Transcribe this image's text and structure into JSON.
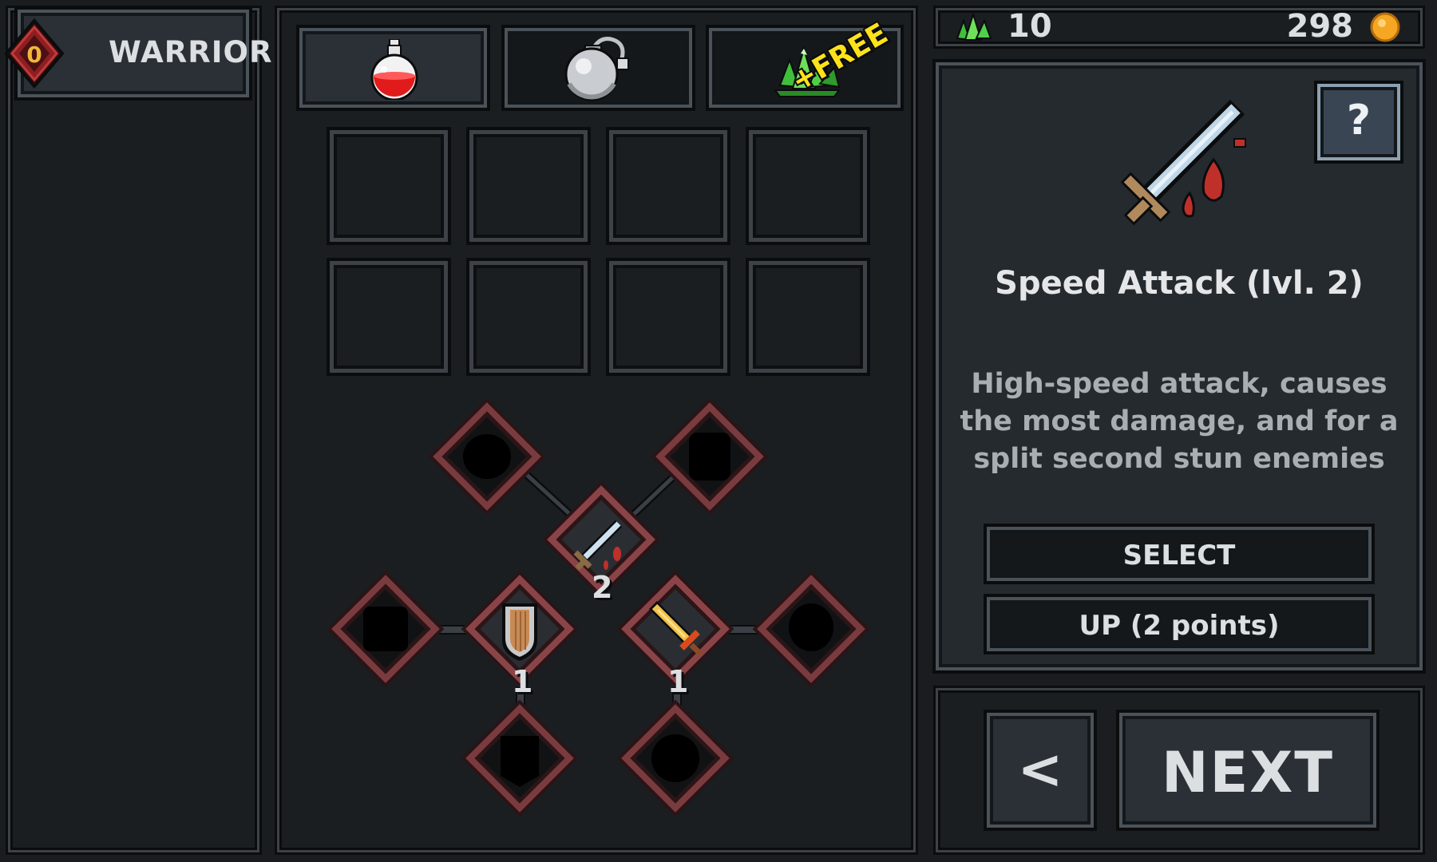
{
  "player": {
    "class_name": "WARRIOR",
    "level": "0"
  },
  "tabs": [
    {
      "name": "potion",
      "icon": "potion-icon"
    },
    {
      "name": "bomb",
      "icon": "bomb-icon"
    },
    {
      "name": "gems",
      "icon": "gem-icon",
      "badge": "+FREE"
    }
  ],
  "currency": {
    "gems": "10",
    "coins": "298"
  },
  "skill": {
    "title": "Speed Attack (lvl. 2)",
    "description": "High-speed attack, causes the most damage, and for a split second stun enemies",
    "select_label": "SELECT",
    "up_label": "UP (2 points)"
  },
  "tree": {
    "speed_attack_level": "2",
    "shield_level": "1",
    "fire_sword_level": "1"
  },
  "nav": {
    "back_label": "<",
    "next_label": "NEXT"
  },
  "colors": {
    "accent_red": "#7a3b3f",
    "gem_green": "#6ee05a",
    "coin_gold": "#f5a623",
    "free_yellow": "#ffe31a"
  }
}
